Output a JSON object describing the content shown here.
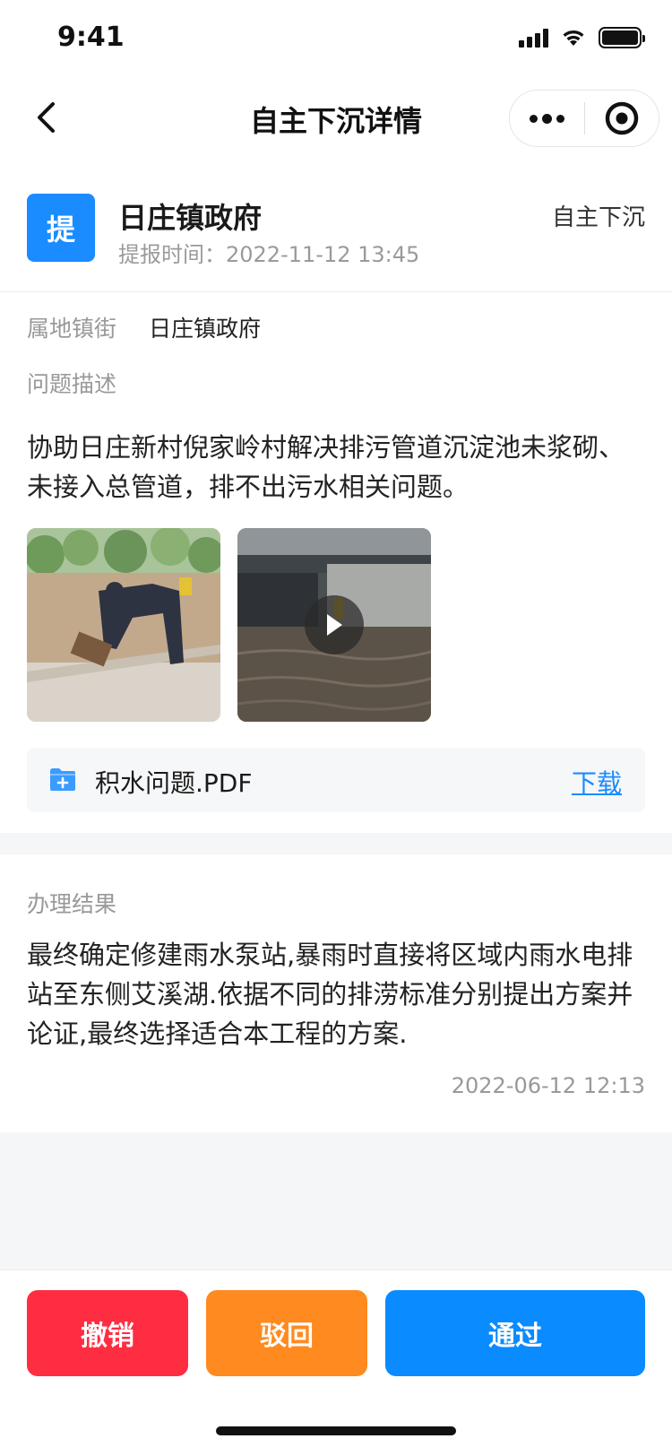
{
  "status_bar": {
    "time": "9:41",
    "icons": [
      "cellular-signal-icon",
      "wifi-icon",
      "battery-icon"
    ]
  },
  "nav": {
    "title": "自主下沉详情",
    "icons": [
      "back-chevron-icon",
      "more-dots-icon",
      "target-circle-icon"
    ]
  },
  "header": {
    "avatar_char": "提",
    "name": "日庄镇政府",
    "time_label": "提报时间：",
    "time_value": "2022-11-12 13:45",
    "type": "自主下沉",
    "avatar_color": "#1a8cff"
  },
  "detail": {
    "town_label": "属地镇街",
    "town_value": "日庄镇政府",
    "desc_label": "问题描述",
    "desc_text": "协助日庄新村倪家岭村解决排污管道沉淀池未浆砌、未接入总管道，排不出污水相关问题。",
    "media": [
      {
        "type": "image",
        "icon": "photo-flood-worker"
      },
      {
        "type": "video",
        "icon": "play-icon"
      }
    ],
    "attachment": {
      "name": "积水问题.PDF",
      "action": "下载",
      "icon": "folder-add-icon"
    }
  },
  "result": {
    "label": "办理结果",
    "text": "最终确定修建雨水泵站,暴雨时直接将区域内雨水电排站至东侧艾溪湖.依据不同的排涝标准分别提出方案并论证,最终选择适合本工程的方案.",
    "time": "2022-06-12 12:13"
  },
  "actions": {
    "cancel": "撤销",
    "reject": "驳回",
    "pass": "通过",
    "colors": {
      "cancel": "#ff2d42",
      "reject": "#ff8a1f",
      "pass": "#0a8bff"
    }
  }
}
